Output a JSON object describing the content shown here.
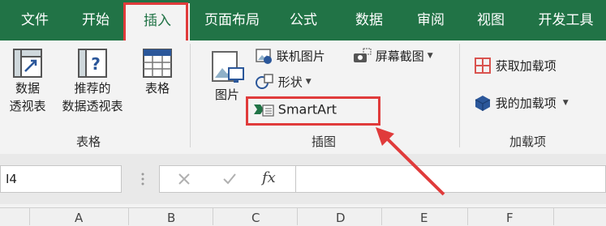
{
  "tabs": [
    "文件",
    "开始",
    "插入",
    "页面布局",
    "公式",
    "数据",
    "审阅",
    "视图",
    "开发工具"
  ],
  "tables_group": {
    "pivot_l1": "数据",
    "pivot_l2": "透视表",
    "rec_l1": "推荐的",
    "rec_l2": "数据透视表",
    "table": "表格",
    "label": "表格"
  },
  "illustrations_group": {
    "picture": "图片",
    "online_pictures": "联机图片",
    "shapes": "形状",
    "screenshot": "屏幕截图",
    "smartart": "SmartArt",
    "label": "插图"
  },
  "addins_group": {
    "get_addins": "获取加载项",
    "my_addins": "我的加载项",
    "label": "加载项"
  },
  "formula_bar": {
    "name_box": "I4",
    "fx": "fx"
  },
  "columns": [
    "A",
    "B",
    "C",
    "D",
    "E",
    "F"
  ],
  "colors": {
    "brand": "#217346",
    "highlight": "#e03b3b"
  }
}
